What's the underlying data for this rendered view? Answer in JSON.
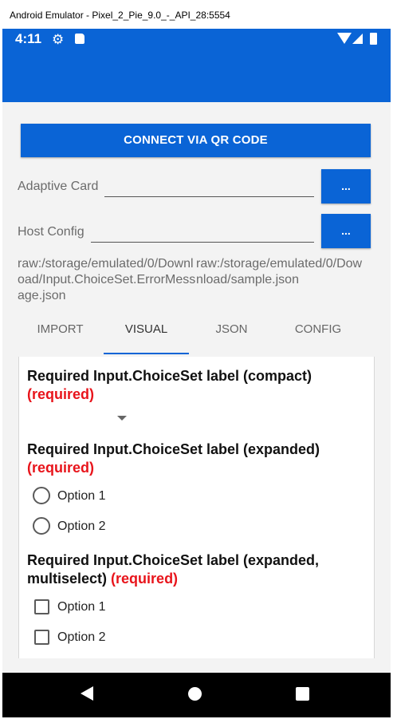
{
  "window": {
    "title": "Android Emulator - Pixel_2_Pie_9.0_-_API_28:5554"
  },
  "statusbar": {
    "time": "4:11"
  },
  "colors": {
    "primary": "#0a64d6",
    "required": "#e8141b"
  },
  "toolbar": {
    "qr_label": "CONNECT VIA QR CODE",
    "adaptive_label": "Adaptive Card",
    "host_label": "Host Config",
    "browse_label": "...",
    "adaptive_path": "raw:/storage/emulated/0/Download/Input.ChoiceSet.ErrorMessage.json",
    "host_path": "raw:/storage/emulated/0/Download/sample.json"
  },
  "tabs": [
    {
      "label": "IMPORT"
    },
    {
      "label": "VISUAL"
    },
    {
      "label": "JSON"
    },
    {
      "label": "CONFIG"
    }
  ],
  "card": {
    "required_suffix": "(required)",
    "q1": "Required Input.ChoiceSet label (compact)",
    "q2": "Required Input.ChoiceSet label (expanded)",
    "q3a": "Required Input.ChoiceSet label (expanded,",
    "q3b": "multiselect)",
    "options": [
      "Option 1",
      "Option 2"
    ]
  }
}
